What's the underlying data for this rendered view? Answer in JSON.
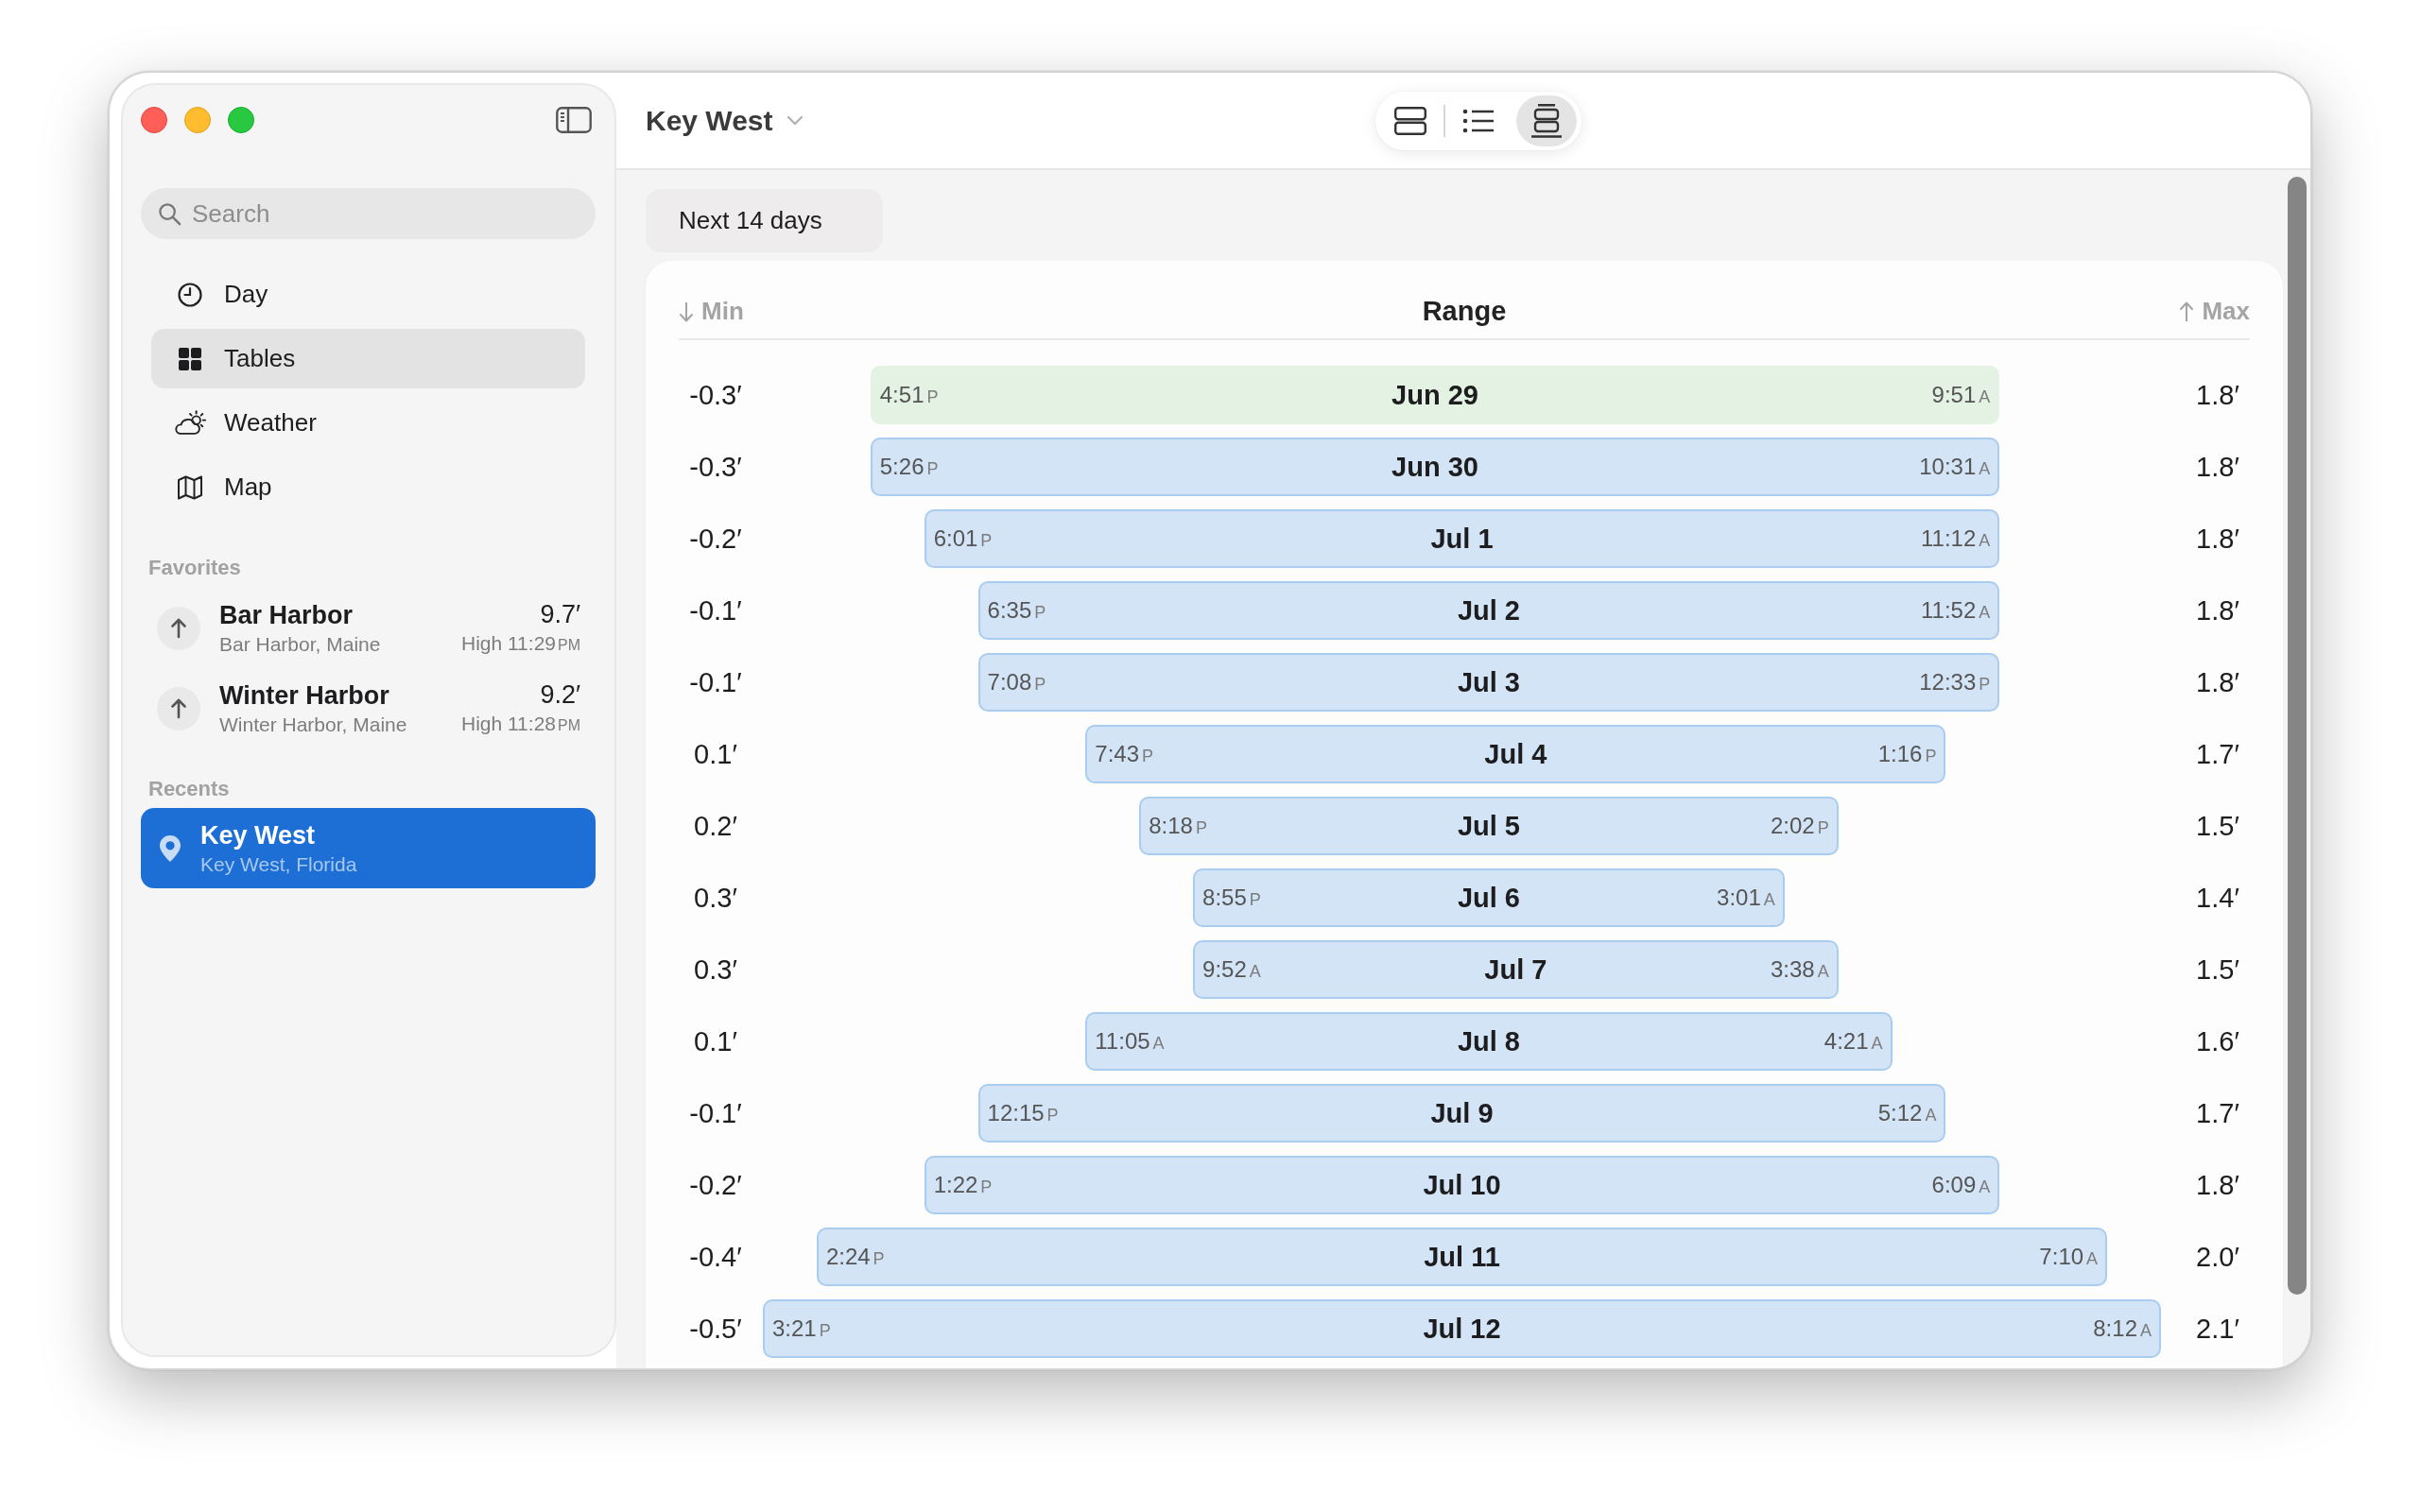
{
  "sidebar": {
    "search": {
      "placeholder": "Search"
    },
    "nav_items": [
      {
        "label": "Day",
        "selected": false
      },
      {
        "label": "Tables",
        "selected": true
      },
      {
        "label": "Weather",
        "selected": false
      },
      {
        "label": "Map",
        "selected": false
      }
    ],
    "favorites": {
      "title": "Favorites",
      "items": [
        {
          "name": "Bar Harbor",
          "location": "Bar Harbor, Maine",
          "height": "9.7′",
          "detail": "High 11:29",
          "period": "PM"
        },
        {
          "name": "Winter Harbor",
          "location": "Winter Harbor, Maine",
          "height": "9.2′",
          "detail": "High 11:28",
          "period": "PM"
        }
      ]
    },
    "recents": {
      "title": "Recents",
      "items": [
        {
          "name": "Key West",
          "location": "Key West, Florida",
          "selected": true
        }
      ]
    }
  },
  "header": {
    "title": "Key West",
    "view_modes": [
      {
        "selected": false
      },
      {
        "selected": false
      },
      {
        "selected": true
      }
    ]
  },
  "range_tab": {
    "label": "Next 14 days"
  },
  "table": {
    "columns": [
      {
        "label": "Min"
      },
      {
        "label": "Range"
      },
      {
        "label": "Max"
      }
    ],
    "rows": [
      {
        "min": "-0.3′",
        "min_time": "4:51P",
        "date": "Jun 29",
        "max_time": "9:51A",
        "max": "1.8′",
        "today": true
      },
      {
        "min": "-0.3′",
        "min_time": "5:26P",
        "date": "Jun 30",
        "max_time": "10:31A",
        "max": "1.8′",
        "today": false
      },
      {
        "min": "-0.2′",
        "min_time": "6:01P",
        "date": "Jul 1",
        "max_time": "11:12A",
        "max": "1.8′",
        "today": false
      },
      {
        "min": "-0.1′",
        "min_time": "6:35P",
        "date": "Jul 2",
        "max_time": "11:52A",
        "max": "1.8′",
        "today": false
      },
      {
        "min": "-0.1′",
        "min_time": "7:08P",
        "date": "Jul 3",
        "max_time": "12:33P",
        "max": "1.8′",
        "today": false
      },
      {
        "min": "0.1′",
        "min_time": "7:43P",
        "date": "Jul 4",
        "max_time": "1:16P",
        "max": "1.7′",
        "today": false
      },
      {
        "min": "0.2′",
        "min_time": "8:18P",
        "date": "Jul 5",
        "max_time": "2:02P",
        "max": "1.5′",
        "today": false
      },
      {
        "min": "0.3′",
        "min_time": "8:55P",
        "date": "Jul 6",
        "max_time": "3:01A",
        "max": "1.4′",
        "today": false
      },
      {
        "min": "0.3′",
        "min_time": "9:52A",
        "date": "Jul 7",
        "max_time": "3:38A",
        "max": "1.5′",
        "today": false
      },
      {
        "min": "0.1′",
        "min_time": "11:05A",
        "date": "Jul 8",
        "max_time": "4:21A",
        "max": "1.6′",
        "today": false
      },
      {
        "min": "-0.1′",
        "min_time": "12:15P",
        "date": "Jul 9",
        "max_time": "5:12A",
        "max": "1.7′",
        "today": false
      },
      {
        "min": "-0.2′",
        "min_time": "1:22P",
        "date": "Jul 10",
        "max_time": "6:09A",
        "max": "1.8′",
        "today": false
      },
      {
        "min": "-0.4′",
        "min_time": "2:24P",
        "date": "Jul 11",
        "max_time": "7:10A",
        "max": "2.0′",
        "today": false
      },
      {
        "min": "-0.5′",
        "min_time": "3:21P",
        "date": "Jul 12",
        "max_time": "8:12A",
        "max": "2.1′",
        "today": false
      }
    ]
  }
}
